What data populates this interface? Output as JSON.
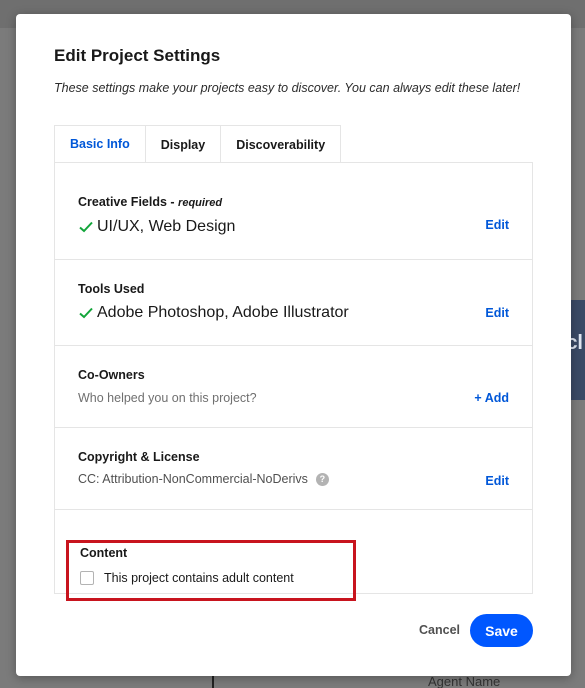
{
  "dialog": {
    "title": "Edit Project Settings",
    "subtitle": "These settings make your projects easy to discover. You can always edit these later!"
  },
  "tabs": [
    {
      "label": "Basic Info",
      "active": true
    },
    {
      "label": "Display",
      "active": false
    },
    {
      "label": "Discoverability",
      "active": false
    }
  ],
  "fields": {
    "creative_fields": {
      "label": "Creative Fields",
      "label_suffix": " - ",
      "required": "required",
      "value": "UI/UX, Web Design",
      "action": "Edit"
    },
    "tools_used": {
      "label": "Tools Used",
      "value": "Adobe Photoshop, Adobe Illustrator",
      "action": "Edit"
    },
    "co_owners": {
      "label": "Co-Owners",
      "placeholder": "Who helped you on this project?",
      "action": "+ Add"
    },
    "copyright": {
      "label": "Copyright & License",
      "value": "CC: Attribution-NonCommercial-NoDerivs",
      "help_glyph": "?",
      "action": "Edit"
    },
    "content": {
      "label": "Content",
      "checkbox_label": "This project contains adult content",
      "checked": false
    }
  },
  "footer": {
    "cancel_label": "Cancel",
    "save_label": "Save"
  },
  "background": {
    "strip_text": "cl",
    "bottom_text": "Agent Name"
  },
  "colors": {
    "accent": "#0057ff",
    "link": "#0057d8",
    "check": "#12a53a",
    "highlight_border": "#c8141e"
  }
}
